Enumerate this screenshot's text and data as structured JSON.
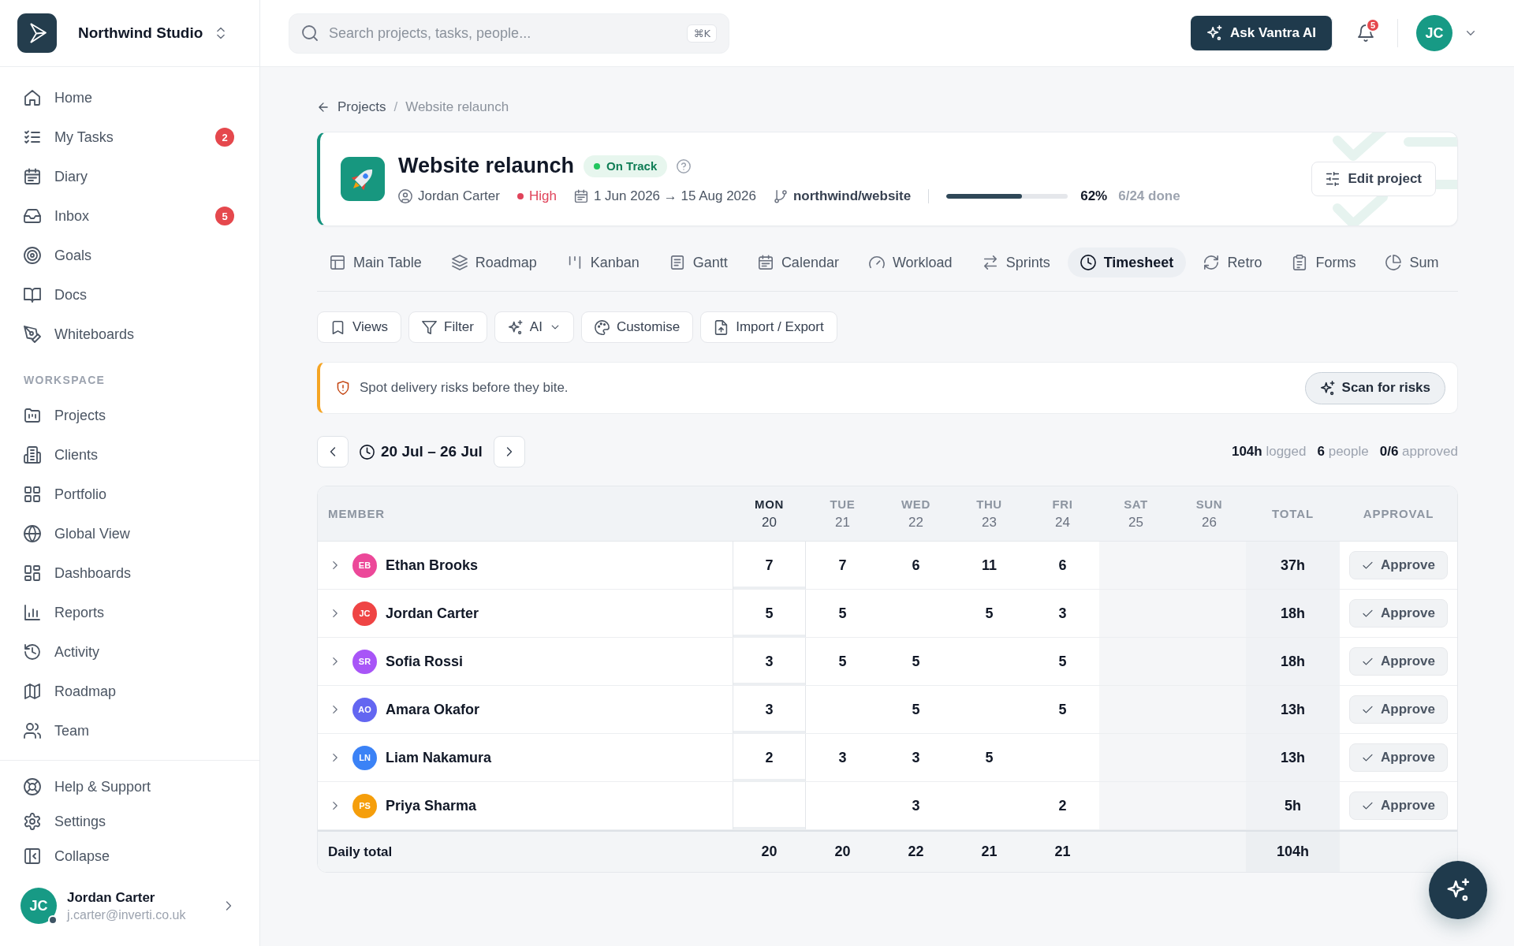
{
  "sidebar": {
    "workspace_name": "Northwind Studio",
    "main_items": [
      {
        "label": "Home",
        "selected": false
      },
      {
        "label": "My Tasks",
        "badge": "2",
        "selected": false
      },
      {
        "label": "Diary",
        "selected": false
      },
      {
        "label": "Inbox",
        "badge": "5",
        "selected": false
      },
      {
        "label": "Goals",
        "selected": false
      },
      {
        "label": "Docs",
        "selected": false
      },
      {
        "label": "Whiteboards",
        "selected": false
      }
    ],
    "section_title": "WORKSPACE",
    "workspace_items": [
      {
        "label": "Projects",
        "selected": false
      },
      {
        "label": "Clients",
        "selected": false
      },
      {
        "label": "Portfolio",
        "selected": false
      },
      {
        "label": "Global View",
        "selected": false
      },
      {
        "label": "Dashboards",
        "selected": false
      },
      {
        "label": "Reports",
        "selected": false
      },
      {
        "label": "Activity",
        "selected": false
      },
      {
        "label": "Roadmap",
        "selected": false
      },
      {
        "label": "Team",
        "selected": false
      }
    ],
    "footer_items": [
      {
        "label": "Help & Support"
      },
      {
        "label": "Settings"
      },
      {
        "label": "Collapse"
      }
    ],
    "user": {
      "initials": "JC",
      "name": "Jordan Carter",
      "email": "j.carter@inverti.co.uk",
      "online": true
    }
  },
  "top_bar": {
    "search": {
      "placeholder": "Search projects, tasks, people...",
      "shortcut": "⌘K"
    },
    "ai_button": "Ask Vantra AI",
    "notifications": {
      "count": "5"
    },
    "user": {
      "initials": "JC"
    }
  },
  "breadcrumb": {
    "items": [
      {
        "label": "Projects",
        "kind": "link"
      },
      {
        "label": "Website relaunch",
        "kind": "current"
      }
    ],
    "separator": "/"
  },
  "project": {
    "title": "Website relaunch",
    "status": {
      "label": "On Track",
      "kind": "on_track"
    },
    "owner": "Jordan Carter",
    "priority": {
      "label": "High",
      "kind": "high"
    },
    "dates": "1 Jun 2026 → 15 Aug 2026",
    "repository": "northwind/website",
    "progress": {
      "level": 0.62,
      "percent": "62%",
      "done": "6/24 done"
    },
    "edit_button": "Edit project"
  },
  "tabs": [
    {
      "label": "Main Table",
      "selected": false
    },
    {
      "label": "Roadmap",
      "selected": false
    },
    {
      "label": "Kanban",
      "selected": false
    },
    {
      "label": "Gantt",
      "selected": false
    },
    {
      "label": "Calendar",
      "selected": false
    },
    {
      "label": "Workload",
      "selected": false
    },
    {
      "label": "Sprints",
      "selected": false
    },
    {
      "label": "Timesheet",
      "selected": true
    },
    {
      "label": "Retro",
      "selected": false
    },
    {
      "label": "Forms",
      "selected": false
    },
    {
      "label": "Sum",
      "selected": false
    }
  ],
  "toolbar": [
    {
      "label": "Views",
      "dropdown": false
    },
    {
      "label": "Filter",
      "dropdown": false
    },
    {
      "label": "AI",
      "dropdown": true
    },
    {
      "label": "Customise",
      "dropdown": false
    },
    {
      "label": "Import / Export",
      "dropdown": false
    }
  ],
  "banner": {
    "text": "Spot delivery risks before they bite.",
    "button": "Scan for risks"
  },
  "week": {
    "range": "20 Jul – 26 Jul",
    "stats": [
      "**104h** logged",
      "**6** people",
      "**0/6** approved"
    ]
  },
  "table": {
    "columns": {
      "member": "MEMBER",
      "total": "TOTAL",
      "approval": "APPROVAL"
    },
    "days": [
      {
        "name": "MON",
        "date": "20",
        "today": true,
        "weekend": false
      },
      {
        "name": "TUE",
        "date": "21",
        "today": false,
        "weekend": false
      },
      {
        "name": "WED",
        "date": "22",
        "today": false,
        "weekend": false
      },
      {
        "name": "THU",
        "date": "23",
        "today": false,
        "weekend": false
      },
      {
        "name": "FRI",
        "date": "24",
        "today": false,
        "weekend": false
      },
      {
        "name": "SAT",
        "date": "25",
        "today": false,
        "weekend": true
      },
      {
        "name": "SUN",
        "date": "26",
        "today": false,
        "weekend": true
      }
    ],
    "rows": [
      {
        "initials": "EB",
        "name": "Ethan Brooks",
        "color": "#ec4899",
        "expanded": false,
        "cells": [
          {
            "kind": "hours",
            "value": "7"
          },
          {
            "kind": "hours",
            "value": "7"
          },
          {
            "kind": "hours",
            "value": "6"
          },
          {
            "kind": "hours",
            "value": "11"
          },
          {
            "kind": "hours",
            "value": "6"
          },
          {
            "kind": "blank"
          },
          {
            "kind": "blank"
          }
        ],
        "total": "37h",
        "action": "Approve"
      },
      {
        "initials": "JC",
        "name": "Jordan Carter",
        "color": "#ef4444",
        "expanded": false,
        "cells": [
          {
            "kind": "hours",
            "value": "5"
          },
          {
            "kind": "hours",
            "value": "5"
          },
          {
            "kind": "blank"
          },
          {
            "kind": "hours",
            "value": "5"
          },
          {
            "kind": "hours",
            "value": "3"
          },
          {
            "kind": "blank"
          },
          {
            "kind": "blank"
          }
        ],
        "total": "18h",
        "action": "Approve"
      },
      {
        "initials": "SR",
        "name": "Sofia Rossi",
        "color": "#a855f7",
        "expanded": false,
        "cells": [
          {
            "kind": "hours",
            "value": "3"
          },
          {
            "kind": "hours",
            "value": "5"
          },
          {
            "kind": "hours",
            "value": "5"
          },
          {
            "kind": "blank"
          },
          {
            "kind": "hours",
            "value": "5"
          },
          {
            "kind": "blank"
          },
          {
            "kind": "blank"
          }
        ],
        "total": "18h",
        "action": "Approve"
      },
      {
        "initials": "AO",
        "name": "Amara Okafor",
        "color": "#6366f1",
        "expanded": false,
        "cells": [
          {
            "kind": "hours",
            "value": "3"
          },
          {
            "kind": "blank"
          },
          {
            "kind": "hours",
            "value": "5"
          },
          {
            "kind": "blank"
          },
          {
            "kind": "hours",
            "value": "5"
          },
          {
            "kind": "blank"
          },
          {
            "kind": "blank"
          }
        ],
        "total": "13h",
        "action": "Approve"
      },
      {
        "initials": "LN",
        "name": "Liam Nakamura",
        "color": "#3b82f6",
        "expanded": false,
        "cells": [
          {
            "kind": "hours",
            "value": "2"
          },
          {
            "kind": "hours",
            "value": "3"
          },
          {
            "kind": "hours",
            "value": "3"
          },
          {
            "kind": "hours",
            "value": "5"
          },
          {
            "kind": "blank"
          },
          {
            "kind": "blank"
          },
          {
            "kind": "blank"
          }
        ],
        "total": "13h",
        "action": "Approve"
      },
      {
        "initials": "PS",
        "name": "Priya Sharma",
        "color": "#f59e0b",
        "expanded": false,
        "cells": [
          {
            "kind": "blank"
          },
          {
            "kind": "blank"
          },
          {
            "kind": "hours",
            "value": "3"
          },
          {
            "kind": "blank"
          },
          {
            "kind": "hours",
            "value": "2"
          },
          {
            "kind": "blank"
          },
          {
            "kind": "blank"
          }
        ],
        "total": "5h",
        "action": "Approve"
      }
    ],
    "footer": {
      "label": "Daily total",
      "cells": [
        {
          "kind": "hours",
          "value": "20"
        },
        {
          "kind": "hours",
          "value": "20"
        },
        {
          "kind": "hours",
          "value": "22"
        },
        {
          "kind": "hours",
          "value": "21"
        },
        {
          "kind": "hours",
          "value": "21"
        },
        {
          "kind": "blank"
        },
        {
          "kind": "blank"
        }
      ],
      "total": "104h"
    }
  }
}
